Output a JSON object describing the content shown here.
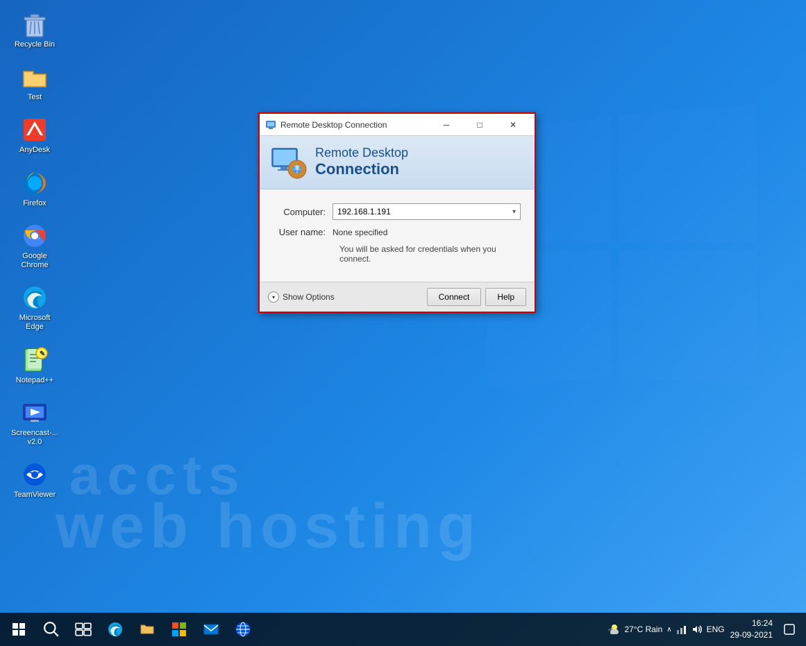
{
  "desktop": {
    "background": "#1565c0",
    "watermark": {
      "line1": "accts",
      "line2": "web hosting"
    }
  },
  "desktop_icons": [
    {
      "id": "recycle-bin",
      "label": "Recycle Bin"
    },
    {
      "id": "test",
      "label": "Test"
    },
    {
      "id": "anydesk",
      "label": "AnyDesk"
    },
    {
      "id": "firefox",
      "label": "Firefox"
    },
    {
      "id": "google-chrome",
      "label": "Google Chrome"
    },
    {
      "id": "microsoft-edge",
      "label": "Microsoft Edge"
    },
    {
      "id": "notepadpp",
      "label": "Notepad++"
    },
    {
      "id": "screencast",
      "label": "Screencast-...\nv2.0"
    },
    {
      "id": "teamviewer",
      "label": "TeamViewer"
    }
  ],
  "rdp_dialog": {
    "title": "Remote Desktop Connection",
    "header_line1": "Remote Desktop",
    "header_line2": "Connection",
    "computer_label": "Computer:",
    "computer_value": "192.168.1.191",
    "username_label": "User name:",
    "username_value": "None specified",
    "credentials_note": "You will be asked for credentials when you connect.",
    "show_options_label": "Show Options",
    "connect_button": "Connect",
    "help_button": "Help",
    "window_controls": {
      "minimize": "─",
      "maximize": "□",
      "close": "✕"
    }
  },
  "taskbar": {
    "start_label": "Start",
    "weather": "27°C  Rain",
    "language": "ENG",
    "time": "16:24",
    "date": "29-09-2021"
  }
}
